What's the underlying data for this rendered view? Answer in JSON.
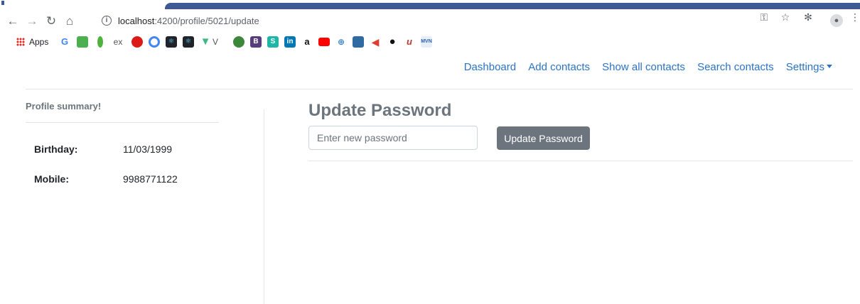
{
  "browser": {
    "url_host": "localhost",
    "url_path": ":4200/profile/5021/update",
    "bookmarks": {
      "apps_label": "Apps",
      "items": [
        "G",
        "ex",
        "V",
        "B",
        "S",
        "in",
        "a"
      ]
    }
  },
  "navbar": {
    "links": [
      "Dashboard",
      "Add contacts",
      "Show all contacts",
      "Search contacts"
    ],
    "settings_label": "Settings"
  },
  "sidebar": {
    "title": "Profile summary!",
    "fields": [
      {
        "label": "Birthday:",
        "value": "11/03/1999"
      },
      {
        "label": "Mobile:",
        "value": "9988771122"
      }
    ]
  },
  "main": {
    "title": "Update Password",
    "password_placeholder": "Enter new password",
    "submit_label": "Update Password"
  },
  "colors": {
    "link": "#2b73c7",
    "button": "#6c757d",
    "tab_strip": "#3d5a94"
  }
}
